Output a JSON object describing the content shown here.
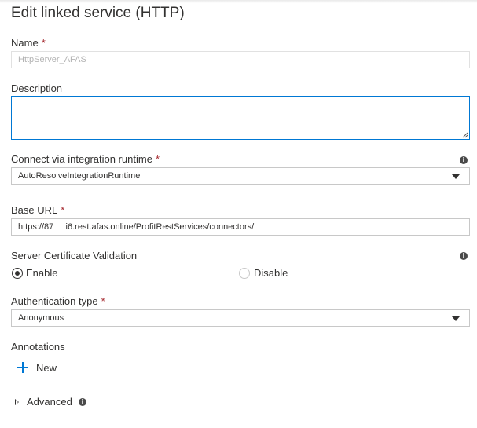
{
  "panel": {
    "title": "Edit linked service (HTTP)"
  },
  "name": {
    "label": "Name",
    "required": "*",
    "value": "HttpServer_AFAS"
  },
  "description": {
    "label": "Description",
    "value": ""
  },
  "runtime": {
    "label": "Connect via integration runtime",
    "required": "*",
    "value": "AutoResolveIntegrationRuntime",
    "info_icon": "info-icon"
  },
  "base_url": {
    "label": "Base URL",
    "required": "*",
    "value": "https://87     i6.rest.afas.online/ProfitRestServices/connectors/"
  },
  "cert_validation": {
    "label": "Server Certificate Validation",
    "options": [
      {
        "label": "Enable",
        "checked": true
      },
      {
        "label": "Disable",
        "checked": false
      }
    ]
  },
  "auth": {
    "label": "Authentication type",
    "required": "*",
    "value": "Anonymous"
  },
  "annotations": {
    "label": "Annotations",
    "new_label": "New"
  },
  "advanced": {
    "label": "Advanced"
  },
  "colors": {
    "accent": "#0078d4",
    "required": "#a4262c",
    "text": "#323130",
    "border": "#c8c8c8"
  }
}
